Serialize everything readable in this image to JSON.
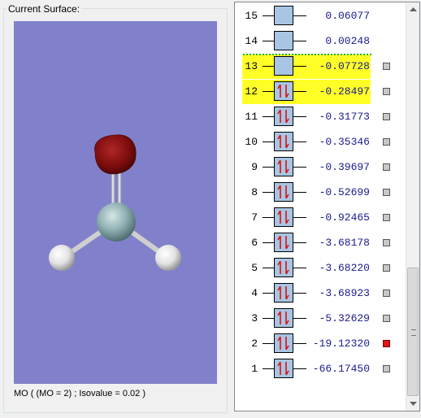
{
  "surface_group": {
    "title": "Current Surface:",
    "status": "MO ( (MO = 2) ; Isovalue = 0.02 )"
  },
  "viewport": {
    "background": "#8181cb",
    "atoms": [
      "oxygen-atom",
      "carbon-atom",
      "hydrogen-atom",
      "hydrogen-atom"
    ],
    "surface_color": "#8b1010"
  },
  "mo_list": {
    "rows": [
      {
        "index": "15",
        "energy": "0.06077",
        "occupied": false,
        "highlighted": false,
        "checkbox": "none"
      },
      {
        "index": "14",
        "energy": "0.00248",
        "occupied": false,
        "highlighted": false,
        "checkbox": "none"
      },
      {
        "index": "13",
        "energy": "-0.07728",
        "occupied": false,
        "highlighted": true,
        "checkbox": "gray"
      },
      {
        "index": "12",
        "energy": "-0.28497",
        "occupied": true,
        "highlighted": true,
        "checkbox": "gray"
      },
      {
        "index": "11",
        "energy": "-0.31773",
        "occupied": true,
        "highlighted": false,
        "checkbox": "gray"
      },
      {
        "index": "10",
        "energy": "-0.35346",
        "occupied": true,
        "highlighted": false,
        "checkbox": "gray"
      },
      {
        "index": "9",
        "energy": "-0.39697",
        "occupied": true,
        "highlighted": false,
        "checkbox": "gray"
      },
      {
        "index": "8",
        "energy": "-0.52699",
        "occupied": true,
        "highlighted": false,
        "checkbox": "gray"
      },
      {
        "index": "7",
        "energy": "-0.92465",
        "occupied": true,
        "highlighted": false,
        "checkbox": "gray"
      },
      {
        "index": "6",
        "energy": "-3.68178",
        "occupied": true,
        "highlighted": false,
        "checkbox": "gray"
      },
      {
        "index": "5",
        "energy": "-3.68220",
        "occupied": true,
        "highlighted": false,
        "checkbox": "gray"
      },
      {
        "index": "4",
        "energy": "-3.68923",
        "occupied": true,
        "highlighted": false,
        "checkbox": "gray"
      },
      {
        "index": "3",
        "energy": "-5.32629",
        "occupied": true,
        "highlighted": false,
        "checkbox": "gray"
      },
      {
        "index": "2",
        "energy": "-19.12320",
        "occupied": true,
        "highlighted": false,
        "checkbox": "red"
      },
      {
        "index": "1",
        "energy": "-66.17450",
        "occupied": true,
        "highlighted": false,
        "checkbox": "gray"
      }
    ],
    "highlight_color": "#ffff27",
    "orbital_box_color": "#a8c6e4",
    "energy_color": "#1a1a8c"
  }
}
